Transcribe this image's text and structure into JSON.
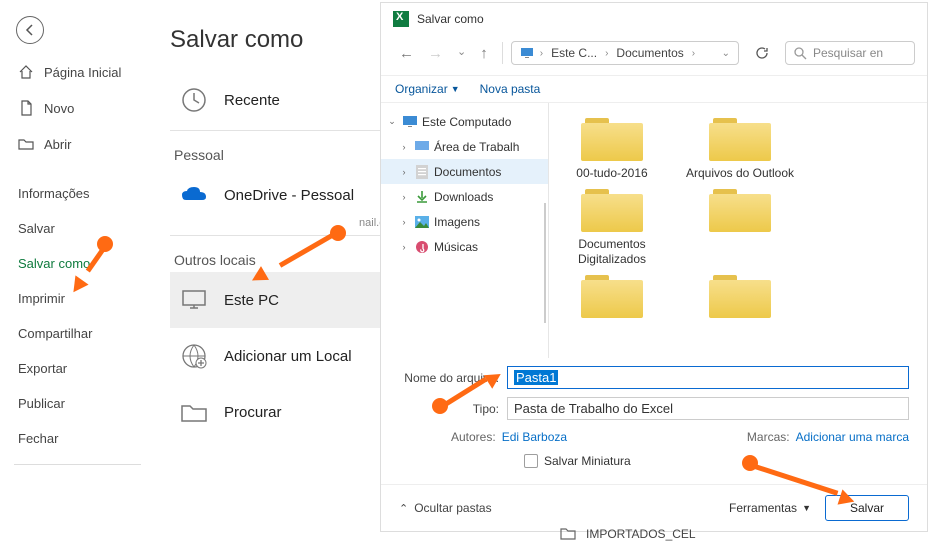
{
  "backstage": {
    "items": [
      {
        "key": "home",
        "label": "Página Inicial"
      },
      {
        "key": "new",
        "label": "Novo"
      },
      {
        "key": "open",
        "label": "Abrir"
      }
    ],
    "items2": [
      {
        "key": "info",
        "label": "Informações"
      },
      {
        "key": "save",
        "label": "Salvar"
      },
      {
        "key": "saveas",
        "label": "Salvar como"
      },
      {
        "key": "print",
        "label": "Imprimir"
      },
      {
        "key": "share",
        "label": "Compartilhar"
      },
      {
        "key": "export",
        "label": "Exportar"
      },
      {
        "key": "publish",
        "label": "Publicar"
      },
      {
        "key": "close",
        "label": "Fechar"
      }
    ]
  },
  "panel": {
    "title": "Salvar como",
    "recent": "Recente",
    "personal": "Pessoal",
    "onedrive": "OneDrive - Pessoal",
    "onedrive_sub": "nail.com",
    "other": "Outros locais",
    "thispc": "Este PC",
    "addplace": "Adicionar um Local",
    "browse": "Procurar"
  },
  "dialog": {
    "title": "Salvar como",
    "path_seg1": "Este C...",
    "path_seg2": "Documentos",
    "refresh_dropdown_chevron": "▾",
    "search_placeholder": "Pesquisar en",
    "toolbar_organize": "Organizar",
    "toolbar_newfolder": "Nova pasta",
    "tree": {
      "root": "Este Computado",
      "nodes": [
        {
          "key": "desktop",
          "label": "Área de Trabalh"
        },
        {
          "key": "docs",
          "label": "Documentos"
        },
        {
          "key": "downloads",
          "label": "Downloads"
        },
        {
          "key": "pictures",
          "label": "Imagens"
        },
        {
          "key": "music",
          "label": "Músicas"
        }
      ]
    },
    "folders": [
      {
        "label": "00-tudo-2016"
      },
      {
        "label": "Arquivos do Outlook"
      },
      {
        "label": "Documentos Digitalizados"
      }
    ],
    "filename_label": "Nome do arquivo:",
    "filename_value": "Pasta1",
    "type_label": "Tipo:",
    "type_value": "Pasta de Trabalho do Excel",
    "authors_label": "Autores:",
    "authors_value": "Edi Barboza",
    "tags_label": "Marcas:",
    "tags_value": "Adicionar uma marca",
    "thumb_label": "Salvar Miniatura",
    "hidefolders": "Ocultar pastas",
    "tools": "Ferramentas",
    "save": "Salvar"
  },
  "below_item": "IMPORTADOS_CEL"
}
